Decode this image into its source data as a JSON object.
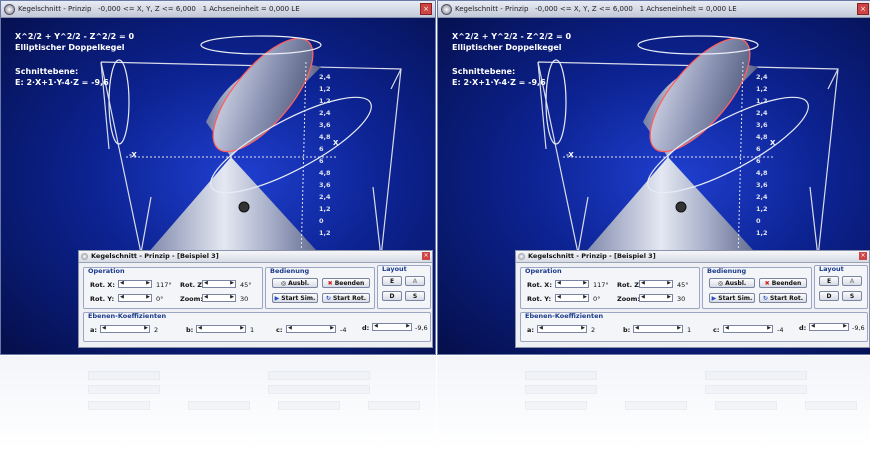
{
  "window": {
    "title": "Kegelschnitt - Prinzip",
    "coords": "-0,000 <= X, Y, Z <= 6,000",
    "unit_label": "1 Achseneinheit =",
    "unit_value": "0,000 LE"
  },
  "formula": {
    "equation": "X^2/2 + Y^2/2 - Z^2/2 = 0",
    "name": "Elliptischer Doppelkegel"
  },
  "plane": {
    "heading": "Schnittebene:",
    "equation": "E: 2·X+1·Y-4·Z = -9,6"
  },
  "axis_labels": {
    "x": "X",
    "neg_x": "-X"
  },
  "tick_labels": [
    "2,4",
    "1,2",
    "1,2",
    "2,4",
    "3,6",
    "4,8",
    "6",
    "6",
    "4,8",
    "3,6",
    "2,4",
    "1,2",
    "0",
    "1,2"
  ],
  "control": {
    "title": "Kegelschnitt - Prinzip - [Beispiel 3]",
    "operation_header": "Operation",
    "rot_x_label": "Rot. X:",
    "rot_x_value": "117°",
    "rot_y_label": "Rot. Y:",
    "rot_y_value": "0°",
    "rot_z_label": "Rot. Z:",
    "rot_z_value": "45°",
    "zoom_label": "Zoom:",
    "zoom_value": "30",
    "bedienung_header": "Bedienung",
    "ausbl_label": "Ausbl.",
    "beenden_label": "Beenden",
    "start_sim_label": "Start Sim.",
    "start_rot_label": "Start Rot.",
    "layout_header": "Layout",
    "layout_e_label": "E",
    "layout_a_label": "A",
    "layout_d_label": "D",
    "layout_s_label": "S",
    "coeff_header": "Ebenen-Koeffizienten",
    "a_label": "a:",
    "a_value": "2",
    "b_label": "b:",
    "b_value": "1",
    "c_label": "c:",
    "c_value": "-4",
    "d_label": "d:",
    "d_value": "-9,6"
  },
  "colors": {
    "background_center": "#1f3fd0",
    "background_edge": "#050f4a",
    "ellipse_outline": "#ff6060",
    "group_header": "#1a3a8a"
  }
}
